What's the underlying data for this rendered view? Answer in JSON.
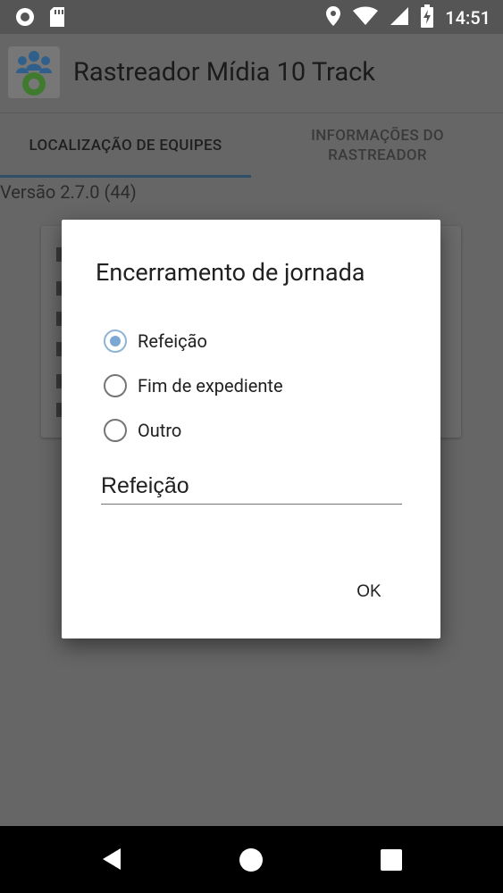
{
  "status_bar": {
    "time": "14:51",
    "icons": [
      "circle-status-icon",
      "sd-card-icon",
      "location-icon",
      "wifi-icon",
      "signal-icon",
      "battery-charging-icon"
    ]
  },
  "app_bar": {
    "title": "Rastreador Mídia 10 Track",
    "logo_icon": "team-gear-logo-icon"
  },
  "tabs": [
    {
      "label": "LOCALIZAÇÃO DE EQUIPES",
      "selected": true
    },
    {
      "label": "INFORMAÇÕES DO RASTREADOR",
      "selected": false
    }
  ],
  "version_text": "Versão 2.7.0 (44)",
  "dialog": {
    "title": "Encerramento de jornada",
    "options": [
      {
        "label": "Refeição",
        "checked": true
      },
      {
        "label": "Fim de expediente",
        "checked": false
      },
      {
        "label": "Outro",
        "checked": false
      }
    ],
    "input_value": "Refeição",
    "ok_label": "OK"
  },
  "colors": {
    "accent": "#7aa8d3",
    "tab_indicator": "#2e4f6a",
    "scrim_background": "#666666"
  },
  "nav_bar": {
    "icons": [
      "back-icon",
      "home-icon",
      "recents-icon"
    ]
  }
}
